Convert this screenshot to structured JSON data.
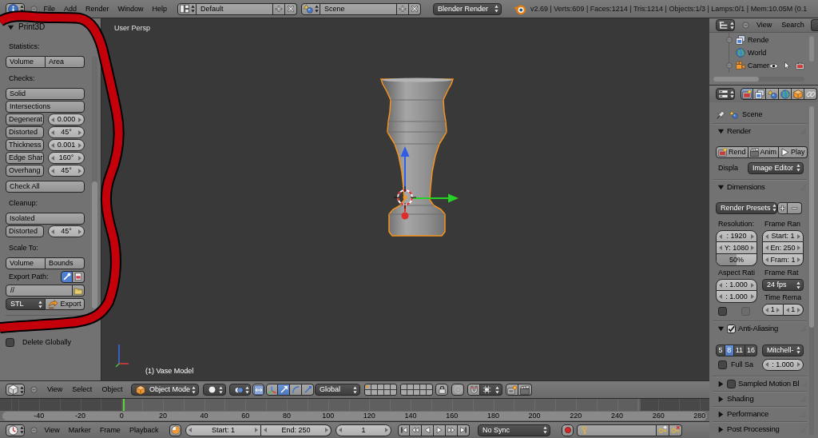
{
  "top_bar": {
    "menus": [
      "File",
      "Add",
      "Render",
      "Window",
      "Help"
    ],
    "screen_layout": "Default",
    "scene": "Scene",
    "render_engine": "Blender Render",
    "stats": "v2.69 | Verts:609 | Faces:1214 | Tris:1214 | Objects:1/3 | Lamps:0/1 | Mem:10.05M (0.1"
  },
  "tool_shelf": {
    "panels": [
      {
        "title": "Print3D",
        "expanded": true,
        "rows": [
          {
            "kind": "label",
            "text": "Statistics:"
          },
          {
            "kind": "buttons",
            "buttons": [
              "Volume",
              "Area"
            ]
          },
          {
            "kind": "label",
            "text": "Checks:"
          },
          {
            "kind": "button",
            "text": "Solid"
          },
          {
            "kind": "button",
            "text": "Intersections"
          },
          {
            "kind": "property",
            "label": "Degenerat",
            "value": "0.000"
          },
          {
            "kind": "property",
            "label": "Distorted",
            "value": "45°"
          },
          {
            "kind": "property",
            "label": "Thickness",
            "value": "0.001"
          },
          {
            "kind": "property",
            "label": "Edge Shar",
            "value": "160°"
          },
          {
            "kind": "property",
            "label": "Overhang",
            "value": "45°"
          },
          {
            "kind": "button",
            "text": "Check All"
          },
          {
            "kind": "label",
            "text": "Cleanup:"
          },
          {
            "kind": "button",
            "text": "Isolated"
          },
          {
            "kind": "property",
            "label": "Distorted",
            "value": "45°"
          },
          {
            "kind": "label",
            "text": "Scale To:"
          },
          {
            "kind": "buttons",
            "buttons": [
              "Volume",
              "Bounds"
            ]
          },
          {
            "kind": "path_label",
            "text": "Export Path:"
          },
          {
            "kind": "path",
            "value": "//"
          },
          {
            "kind": "export",
            "format": "STL",
            "button": "Export"
          }
        ]
      },
      {
        "rows": [
          {
            "kind": "checkbox",
            "label": "Delete Globally",
            "checked": false
          }
        ]
      }
    ]
  },
  "viewport": {
    "view_name": "User Persp",
    "object_name": "(1) Vase Model",
    "object_selected": true
  },
  "view3d_header": {
    "menus": [
      "View",
      "Select",
      "Object"
    ],
    "mode": "Object Mode",
    "manipulators": [
      {
        "kind": "translate",
        "selected": true
      },
      {
        "kind": "rotate",
        "selected": false
      },
      {
        "kind": "scale",
        "selected": false
      }
    ],
    "orientation": "Global",
    "layers": [
      {
        "occupied": true
      },
      {
        "occupied": false
      },
      {
        "occupied": false
      },
      {
        "occupied": false
      },
      {
        "occupied": false
      },
      {
        "occupied": false
      },
      {
        "occupied": false
      },
      {
        "occupied": false
      },
      {
        "occupied": false
      },
      {
        "occupied": false
      },
      {
        "occupied": false
      },
      {
        "occupied": false
      },
      {
        "occupied": false
      },
      {
        "occupied": false
      },
      {
        "occupied": false
      },
      {
        "occupied": false
      },
      {
        "occupied": false
      },
      {
        "occupied": false
      },
      {
        "occupied": false
      },
      {
        "occupied": false
      }
    ]
  },
  "timeline": {
    "ruler": [
      "-40",
      "-20",
      "0",
      "20",
      "40",
      "60",
      "80",
      "100",
      "120",
      "140",
      "160",
      "180",
      "200",
      "220",
      "240",
      "260",
      "280"
    ],
    "menus": [
      "View",
      "Marker",
      "Frame",
      "Playback"
    ],
    "start": "Start: 1",
    "end": "End: 250",
    "current": "1",
    "sync": "No Sync"
  },
  "outliner": {
    "menus": [
      "View",
      "Search"
    ],
    "items": [
      {
        "kind": "render_layers",
        "label": "Rende",
        "expandable": true,
        "restrictions": false
      },
      {
        "kind": "world",
        "label": "World",
        "expandable": false,
        "restrictions": false
      },
      {
        "kind": "camera",
        "label": "Camer",
        "expandable": true,
        "restrictions": true
      }
    ]
  },
  "properties": {
    "tabs": [
      {
        "kind": "render",
        "selected": true
      },
      {
        "kind": "render_layers",
        "selected": false
      },
      {
        "kind": "scene",
        "selected": false
      },
      {
        "kind": "world",
        "selected": false
      },
      {
        "kind": "object",
        "selected": false
      },
      {
        "kind": "constraints",
        "selected": false
      }
    ],
    "context": "Scene",
    "panels": [
      {
        "kind": "render",
        "title": "Render",
        "expanded": true,
        "buttons": [
          {
            "kind": "render",
            "text": "Rend"
          },
          {
            "kind": "animation",
            "text": "Anim"
          },
          {
            "kind": "play",
            "text": "Play"
          }
        ],
        "display_label": "Displa",
        "display": "Image Editor"
      },
      {
        "kind": "dimensions",
        "title": "Dimensions",
        "expanded": true,
        "presets": "Render Presets",
        "left": [
          {
            "kind": "label",
            "text": "Resolution:"
          },
          {
            "kind": "number",
            "text": ": 1920"
          },
          {
            "kind": "number",
            "text": "Y: 1080"
          },
          {
            "kind": "slider",
            "text": "50%",
            "level": 0.5
          },
          {
            "kind": "label",
            "text": "Aspect Rati"
          },
          {
            "kind": "number",
            "text": ": 1.000"
          },
          {
            "kind": "number",
            "text": ": 1.000"
          },
          {
            "kind": "checkboxes",
            "items": [
              {
                "checked": false,
                "disabled": false
              },
              {
                "checked": false,
                "disabled": true
              }
            ]
          }
        ],
        "right": [
          {
            "kind": "label",
            "text": "Frame Ran"
          },
          {
            "kind": "number",
            "text": "Start: 1"
          },
          {
            "kind": "number",
            "text": "En: 250"
          },
          {
            "kind": "number",
            "text": "Fram: 1"
          },
          {
            "kind": "label",
            "text": "Frame Rat"
          },
          {
            "kind": "menu",
            "text": "24 fps"
          },
          {
            "kind": "label",
            "text": "Time Rema"
          },
          {
            "kind": "number_pair",
            "values": [
              "1",
              "1"
            ]
          }
        ]
      },
      {
        "kind": "anti_aliasing",
        "title": "Anti-Aliasing",
        "expanded": true,
        "checked": true,
        "samples": [
          {
            "label": "5",
            "selected": false
          },
          {
            "label": "8",
            "selected": true
          },
          {
            "label": "11",
            "selected": false
          },
          {
            "label": "16",
            "selected": false
          }
        ],
        "filter": "Mitchell-",
        "full_sample": {
          "label": "Full Sa",
          "checked": false
        },
        "filter_size": ": 1.000"
      },
      {
        "title": "Sampled Motion Bl",
        "expanded": false,
        "checked": false
      },
      {
        "title": "Shading",
        "expanded": false
      },
      {
        "title": "Performance",
        "expanded": false
      },
      {
        "title": "Post Processing",
        "expanded": false
      }
    ]
  },
  "highlight": {
    "kind": "freehand_loop"
  }
}
